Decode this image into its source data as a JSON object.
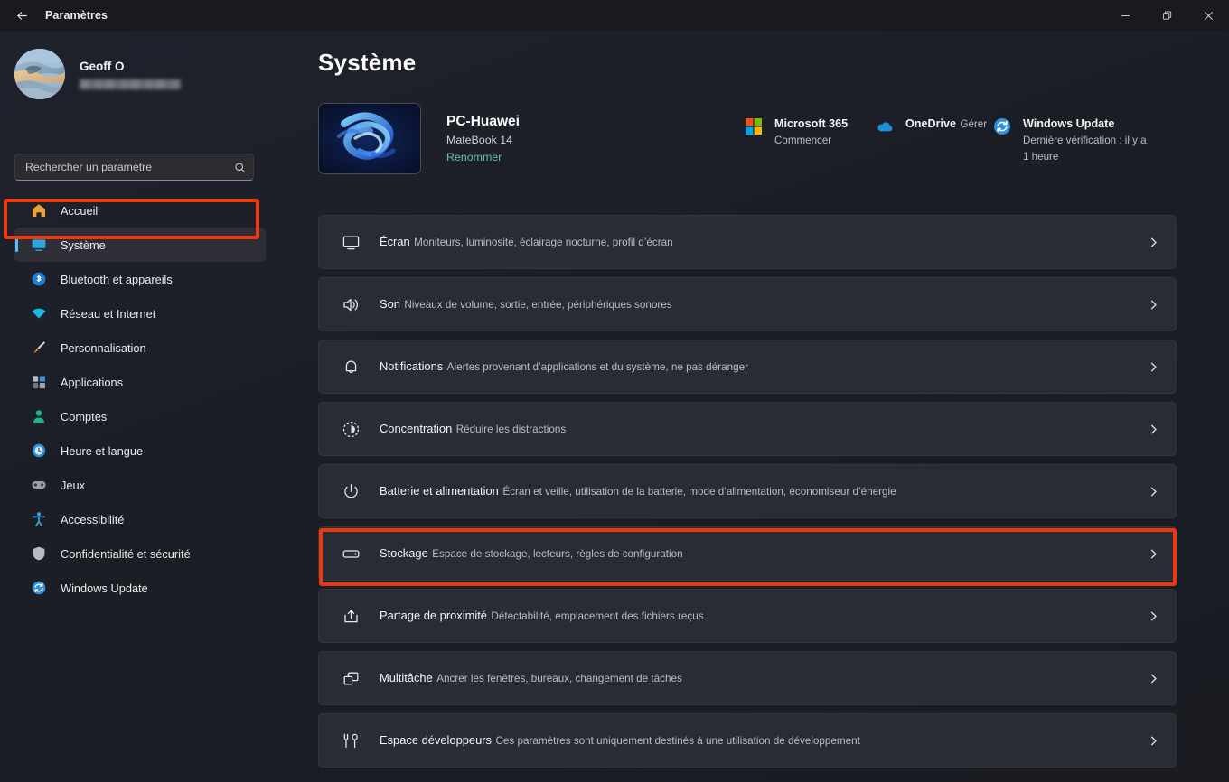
{
  "window": {
    "title": "Paramètres",
    "back_icon": "back-arrow-icon",
    "minimize_label": "—",
    "maximize_label": "❐",
    "close_label": "✕"
  },
  "sidebar": {
    "profile": {
      "name": "Geoff O",
      "email_redacted": ""
    },
    "search": {
      "placeholder": "Rechercher un paramètre",
      "value": "",
      "icon": "search-icon"
    },
    "items": [
      {
        "label": "Accueil",
        "icon": "home-icon",
        "selected": false
      },
      {
        "label": "Système",
        "icon": "monitor-icon",
        "selected": true
      },
      {
        "label": "Bluetooth et appareils",
        "icon": "bluetooth-icon",
        "selected": false
      },
      {
        "label": "Réseau et Internet",
        "icon": "wifi-icon",
        "selected": false
      },
      {
        "label": "Personnalisation",
        "icon": "brush-icon",
        "selected": false
      },
      {
        "label": "Applications",
        "icon": "apps-icon",
        "selected": false
      },
      {
        "label": "Comptes",
        "icon": "person-icon",
        "selected": false
      },
      {
        "label": "Heure et langue",
        "icon": "clock-icon",
        "selected": false
      },
      {
        "label": "Jeux",
        "icon": "gamepad-icon",
        "selected": false
      },
      {
        "label": "Accessibilité",
        "icon": "accessibility-icon",
        "selected": false
      },
      {
        "label": "Confidentialité et sécurité",
        "icon": "shield-icon",
        "selected": false
      },
      {
        "label": "Windows Update",
        "icon": "update-icon",
        "selected": false
      }
    ]
  },
  "main": {
    "page_title": "Système",
    "device": {
      "name": "PC-Huawei",
      "model": "MateBook 14",
      "rename_label": "Renommer",
      "thumbnail": "windows-bloom-wallpaper"
    },
    "quicklinks": [
      {
        "title": "Microsoft 365",
        "subtitle": "Commencer",
        "icon": "microsoft-365-icon"
      },
      {
        "title": "OneDrive",
        "subtitle": "Gérer",
        "icon": "onedrive-cloud-icon"
      },
      {
        "title": "Windows Update",
        "subtitle": "Dernière vérification : il y a 1 heure",
        "icon": "update-icon"
      }
    ],
    "settings_rows": [
      {
        "title": "Écran",
        "subtitle": "Moniteurs, luminosité, éclairage nocturne, profil d’écran",
        "icon": "monitor-icon",
        "highlighted": false
      },
      {
        "title": "Son",
        "subtitle": "Niveaux de volume, sortie, entrée, périphériques sonores",
        "icon": "speaker-icon",
        "highlighted": false
      },
      {
        "title": "Notifications",
        "subtitle": "Alertes provenant d’applications et du système, ne pas déranger",
        "icon": "bell-icon",
        "highlighted": false
      },
      {
        "title": "Concentration",
        "subtitle": "Réduire les distractions",
        "icon": "focus-icon",
        "highlighted": false
      },
      {
        "title": "Batterie et alimentation",
        "subtitle": "Écran et veille, utilisation de la batterie, mode d’alimentation, économiseur d’énergie",
        "icon": "power-icon",
        "highlighted": false
      },
      {
        "title": "Stockage",
        "subtitle": "Espace de stockage, lecteurs, règles de configuration",
        "icon": "drive-icon",
        "highlighted": true
      },
      {
        "title": "Partage de proximité",
        "subtitle": "Détectabilité, emplacement des fichiers reçus",
        "icon": "share-icon",
        "highlighted": false
      },
      {
        "title": "Multitâche",
        "subtitle": "Ancrer les fenêtres, bureaux, changement de tâches",
        "icon": "multitask-icon",
        "highlighted": false
      },
      {
        "title": "Espace développeurs",
        "subtitle": "Ces paramètres sont uniquement destinés à une utilisation de développement",
        "icon": "devtools-icon",
        "highlighted": false
      }
    ],
    "chevron_icon": "chevron-right-icon"
  },
  "annotations": {
    "color": "#f0380f",
    "targets": [
      "sidebar-item-systeme",
      "settings-row-stockage"
    ]
  }
}
